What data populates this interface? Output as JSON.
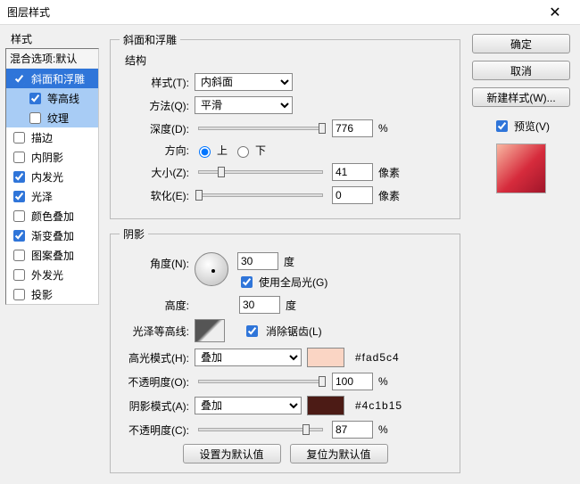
{
  "title": "图层样式",
  "close": "✕",
  "styles_header": "样式",
  "blend_label": "混合选项:默认",
  "styles": {
    "bevel": "斜面和浮雕",
    "contour": "等高线",
    "texture": "纹理",
    "stroke": "描边",
    "inner_shadow": "内阴影",
    "inner_glow": "内发光",
    "satin": "光泽",
    "color_overlay": "颜色叠加",
    "gradient_overlay": "渐变叠加",
    "pattern_overlay": "图案叠加",
    "outer_glow": "外发光",
    "drop_shadow": "投影"
  },
  "bevel": {
    "section": "斜面和浮雕",
    "structure": "结构",
    "style_label": "样式(T):",
    "style_val": "内斜面",
    "technique_label": "方法(Q):",
    "technique_val": "平滑",
    "depth_label": "深度(D):",
    "depth_val": "776",
    "percent": "%",
    "direction_label": "方向:",
    "up": "上",
    "down": "下",
    "size_label": "大小(Z):",
    "size_val": "41",
    "px": "像素",
    "soften_label": "软化(E):",
    "soften_val": "0"
  },
  "shade": {
    "section": "阴影",
    "angle_label": "角度(N):",
    "angle_val": "30",
    "deg": "度",
    "global": "使用全局光(G)",
    "altitude_label": "高度:",
    "altitude_val": "30",
    "gloss_label": "光泽等高线:",
    "antialias": "消除锯齿(L)",
    "highlight_mode_label": "高光模式(H):",
    "highlight_mode_val": "叠加",
    "highlight_hex": "#fad5c4",
    "opacity_label_h": "不透明度(O):",
    "opacity_h": "100",
    "shadow_mode_label": "阴影模式(A):",
    "shadow_mode_val": "叠加",
    "shadow_hex": "#4c1b15",
    "opacity_label_s": "不透明度(C):",
    "opacity_s": "87"
  },
  "buttons": {
    "default_set": "设置为默认值",
    "default_reset": "复位为默认值",
    "ok": "确定",
    "cancel": "取消",
    "new_style": "新建样式(W)...",
    "preview": "预览(V)"
  }
}
